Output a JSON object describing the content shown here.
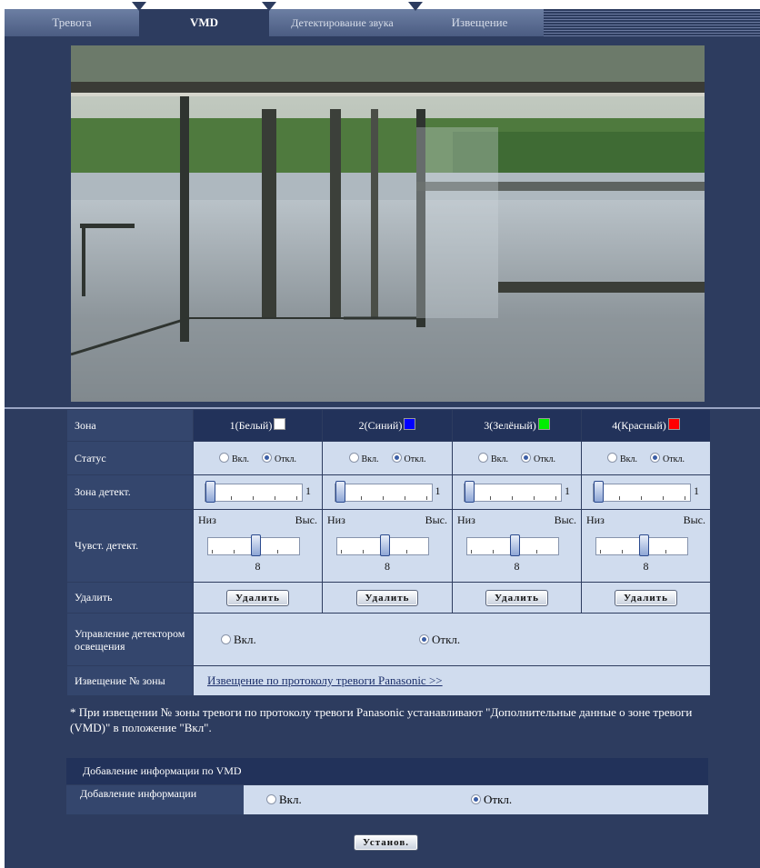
{
  "tabs": [
    {
      "label": "Тревога",
      "active": false
    },
    {
      "label": "VMD",
      "active": true
    },
    {
      "label": "Детектирование звука",
      "active": false
    },
    {
      "label": "Извещение",
      "active": false
    }
  ],
  "table": {
    "zone_label": "Зона",
    "zones": [
      {
        "name": "1(Белый)",
        "color": "#ffffff"
      },
      {
        "name": "2(Синий)",
        "color": "#0000ff"
      },
      {
        "name": "3(Зелёный)",
        "color": "#00ee00"
      },
      {
        "name": "4(Красный)",
        "color": "#ff0000"
      }
    ],
    "status_label": "Статус",
    "status_on": "Вкл.",
    "status_off": "Откл.",
    "status_selected": [
      "off",
      "off",
      "off",
      "off"
    ],
    "detect_area_label": "Зона детект.",
    "detect_area_value": "1",
    "sensitivity_label": "Чувст. детект.",
    "sens_low": "Низ",
    "sens_high": "Выс.",
    "sensitivity_value": "8",
    "sensitivity_level": 0.5,
    "delete_label": "Удалить",
    "delete_button": "Удалить",
    "light_label": "Управление детектором освещения",
    "light_on": "Вкл.",
    "light_off": "Откл.",
    "light_selected": "off",
    "notify_label": "Извещение № зоны",
    "notify_link": "Извещение по протоколу тревоги Panasonic >>"
  },
  "note": "* При извещении № зоны тревоги по протоколу тревоги Panasonic устанавливают \"Дополнительные данные о зоне тревоги (VMD)\" в положение \"Вкл\".",
  "addinfo": {
    "header": "Добавление информации по VMD",
    "label": "Добавление информации",
    "on": "Вкл.",
    "off": "Откл.",
    "selected": "off"
  },
  "set_button": "Установ."
}
